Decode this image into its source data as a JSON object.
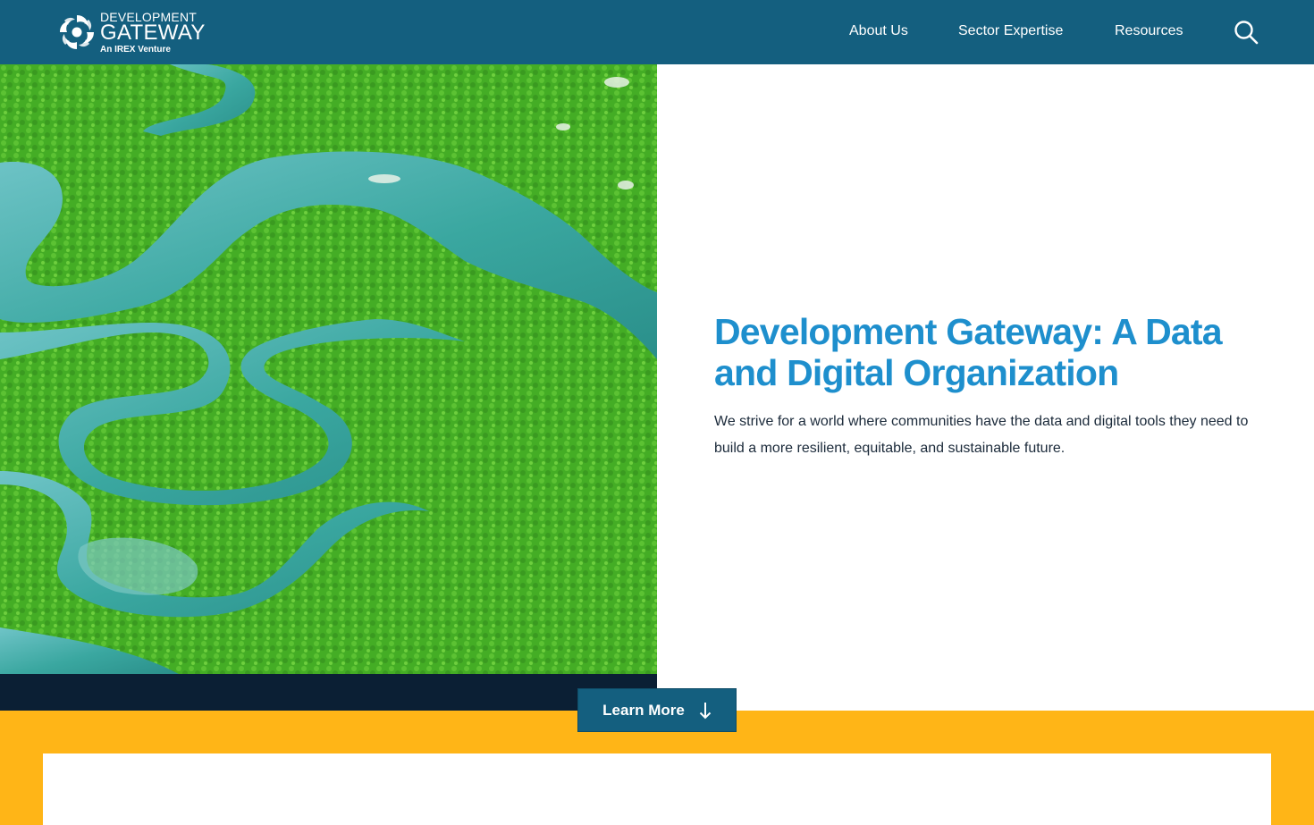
{
  "header": {
    "logo": {
      "line1": "DEVELOPMENT",
      "line2": "GATEWAY",
      "line3": "An IREX Venture"
    },
    "nav": [
      {
        "label": "About Us"
      },
      {
        "label": "Sector Expertise"
      },
      {
        "label": "Resources"
      }
    ],
    "search_icon": "search-icon"
  },
  "hero": {
    "image": "aerial view of a winding river through green mangrove forest",
    "title": "Development Gateway: A Data and Digital Organization",
    "text": "We strive for a world where communities have the data and digital tools they need to build a more resilient, equitable, and sustainable future."
  },
  "cta": {
    "label": "Learn More",
    "icon": "arrow-down-icon"
  },
  "colors": {
    "header": "#145f7f",
    "title": "#1e8fcd",
    "band_dark": "#0b1f34",
    "band_yellow": "#ffb517"
  }
}
